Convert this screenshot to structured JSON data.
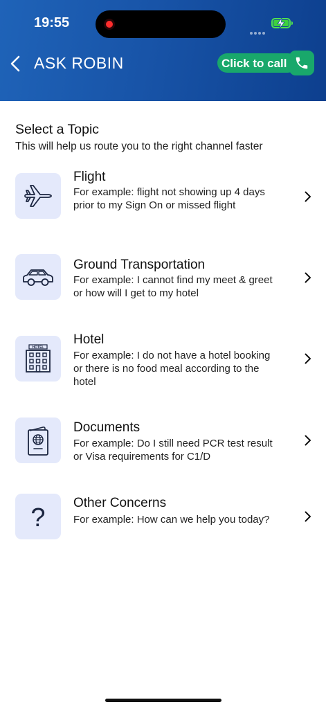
{
  "status_bar": {
    "time": "19:55"
  },
  "nav": {
    "title": "ASK ROBIN",
    "call_label": "Click to call"
  },
  "intro": {
    "heading": "Select a Topic",
    "subheading": "This will help us route you to the right channel faster"
  },
  "topics": [
    {
      "title": "Flight",
      "description": "For example: flight not showing up 4 days prior to my Sign On or missed flight",
      "icon": "airplane-icon"
    },
    {
      "title": "Ground Transportation",
      "description": "For example: I cannot find my meet & greet or how will I get to my hotel",
      "icon": "car-icon"
    },
    {
      "title": "Hotel",
      "description": "For example: I do not have a hotel booking or there is no food meal according to the hotel",
      "icon": "hotel-icon",
      "icon_text": "HOTEL"
    },
    {
      "title": "Documents",
      "description": "For example: Do I still need PCR test result or Visa requirements for C1/D",
      "icon": "passport-icon"
    },
    {
      "title": "Other Concerns",
      "description": "For example: How can we help you today?",
      "icon": "question-icon",
      "icon_text": "?"
    }
  ],
  "colors": {
    "header_start": "#1f63b8",
    "header_end": "#0d3f8e",
    "call_green": "#19a86b",
    "icon_bg": "#e4e9fb",
    "icon_stroke": "#1b2540"
  }
}
